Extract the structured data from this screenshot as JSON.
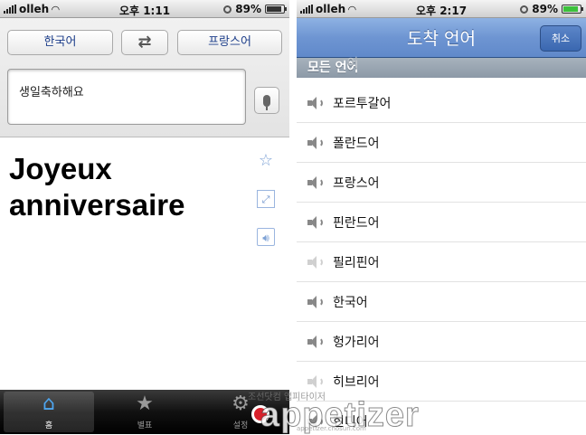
{
  "left": {
    "status": {
      "carrier": "olleh",
      "time": "오후 1:11",
      "battery": "89%",
      "battery_level": 0.89
    },
    "source_language": "한국어",
    "target_language": "프랑스어",
    "input_text": "생일축하해요",
    "translation": "Joyeux anniversaire",
    "side_icons": [
      "star-icon",
      "fullscreen-icon",
      "speaker-icon"
    ],
    "tabs": [
      {
        "label": "홈",
        "icon": "home-icon",
        "active": true
      },
      {
        "label": "별표",
        "icon": "star-icon",
        "active": false
      },
      {
        "label": "설정",
        "icon": "gear-icon",
        "active": false
      }
    ]
  },
  "right": {
    "status": {
      "carrier": "olleh",
      "time": "오후 2:17",
      "battery": "89%",
      "battery_level": 0.89,
      "charging": true
    },
    "title": "도착 언어",
    "cancel_label": "취소",
    "section_header": "모든 언어",
    "section_header_ghost": "어",
    "languages": [
      {
        "label": "포르투갈어",
        "speech": true
      },
      {
        "label": "폴란드어",
        "speech": true
      },
      {
        "label": "프랑스어",
        "speech": true
      },
      {
        "label": "핀란드어",
        "speech": true
      },
      {
        "label": "필리핀어",
        "speech": false
      },
      {
        "label": "한국어",
        "speech": true
      },
      {
        "label": "헝가리어",
        "speech": true
      },
      {
        "label": "히브리어",
        "speech": false
      },
      {
        "label": "힌디어",
        "speech": true
      }
    ]
  },
  "watermark": {
    "text": "조선닷컴 앱피타이저",
    "logo": "appetizer",
    "url": "appetizer.chosun.com"
  }
}
